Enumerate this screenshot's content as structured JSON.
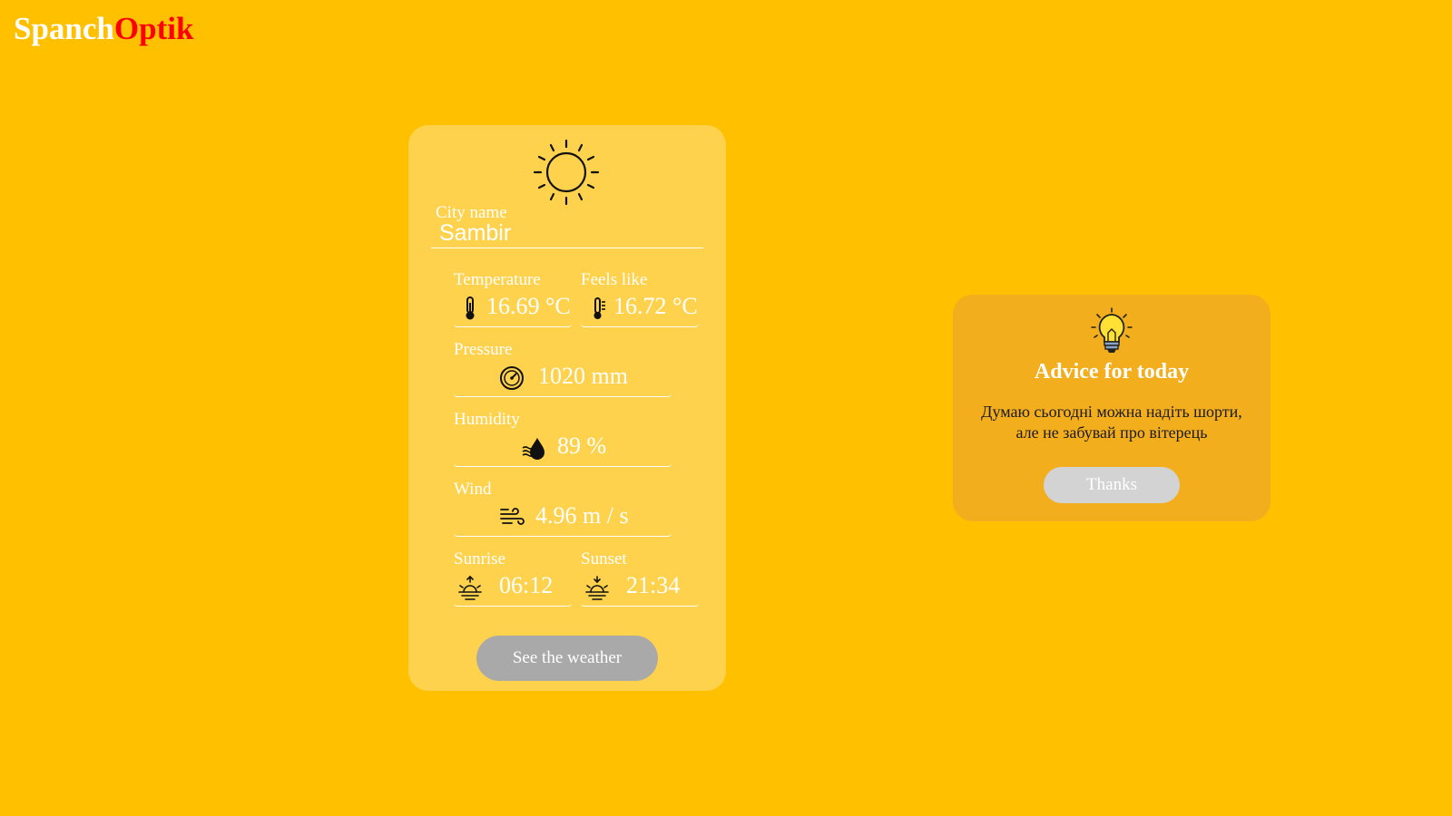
{
  "logo": {
    "part1": "Spanch",
    "part2": "Optik"
  },
  "weather": {
    "city_label": "City name",
    "city_value": "Sambir",
    "temperature": {
      "label": "Temperature",
      "value": "16.69 °C",
      "icon": "thermometer-icon"
    },
    "feels_like": {
      "label": "Feels like",
      "value": "16.72 °C",
      "icon": "thermometer-icon"
    },
    "pressure": {
      "label": "Pressure",
      "value": "1020 mm",
      "icon": "gauge-icon"
    },
    "humidity": {
      "label": "Humidity",
      "value": "89 %",
      "icon": "humidity-icon"
    },
    "wind": {
      "label": "Wind",
      "value": "4.96 m / s",
      "icon": "wind-icon"
    },
    "sunrise": {
      "label": "Sunrise",
      "value": "06:12",
      "icon": "sunrise-icon"
    },
    "sunset": {
      "label": "Sunset",
      "value": "21:34",
      "icon": "sunset-icon"
    },
    "button_label": "See the weather"
  },
  "advice": {
    "title": "Advice for today",
    "text": "Думаю сьогодні можна надіть шорти, але не забувай про вітерець",
    "button_label": "Thanks"
  },
  "colors": {
    "background": "#FFC000",
    "card": "#FFD24D",
    "advice_card": "#F3AE1E",
    "logo_accent": "#FF0000"
  }
}
